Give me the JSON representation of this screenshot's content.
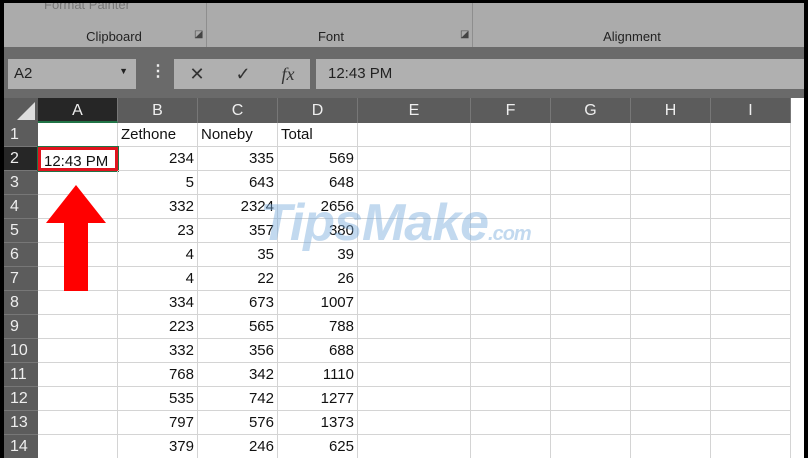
{
  "ribbon": {
    "faded_item": "Format Painter",
    "groups": [
      "Clipboard",
      "Font",
      "Alignment"
    ],
    "launcher_icon": "dialog-launcher-icon"
  },
  "formula_bar": {
    "name_box": "A2",
    "cancel_icon": "✕",
    "enter_icon": "✓",
    "fx_icon": "fx",
    "value": "12:43 PM"
  },
  "columns": [
    "A",
    "B",
    "C",
    "D",
    "E",
    "F",
    "G",
    "H",
    "I"
  ],
  "rows": [
    {
      "n": "1",
      "A": "",
      "B": "Zethone",
      "C": "Noneby",
      "D": "Total"
    },
    {
      "n": "2",
      "A": "12:43 PM",
      "B": "234",
      "C": "335",
      "D": "569"
    },
    {
      "n": "3",
      "A": "",
      "B": "5",
      "C": "643",
      "D": "648"
    },
    {
      "n": "4",
      "A": "",
      "B": "332",
      "C": "2324",
      "D": "2656"
    },
    {
      "n": "5",
      "A": "",
      "B": "23",
      "C": "357",
      "D": "380"
    },
    {
      "n": "6",
      "A": "",
      "B": "4",
      "C": "35",
      "D": "39"
    },
    {
      "n": "7",
      "A": "",
      "B": "4",
      "C": "22",
      "D": "26"
    },
    {
      "n": "8",
      "A": "",
      "B": "334",
      "C": "673",
      "D": "1007"
    },
    {
      "n": "9",
      "A": "",
      "B": "223",
      "C": "565",
      "D": "788"
    },
    {
      "n": "10",
      "A": "",
      "B": "332",
      "C": "356",
      "D": "688"
    },
    {
      "n": "11",
      "A": "",
      "B": "768",
      "C": "342",
      "D": "1110"
    },
    {
      "n": "12",
      "A": "",
      "B": "535",
      "C": "742",
      "D": "1277"
    },
    {
      "n": "13",
      "A": "",
      "B": "797",
      "C": "576",
      "D": "1373"
    },
    {
      "n": "14",
      "A": "",
      "B": "379",
      "C": "246",
      "D": "625"
    }
  ],
  "watermark": {
    "main": "TipsMake",
    "suffix": ".com"
  },
  "colors": {
    "accent": "#217346",
    "highlight": "#e0141e"
  }
}
